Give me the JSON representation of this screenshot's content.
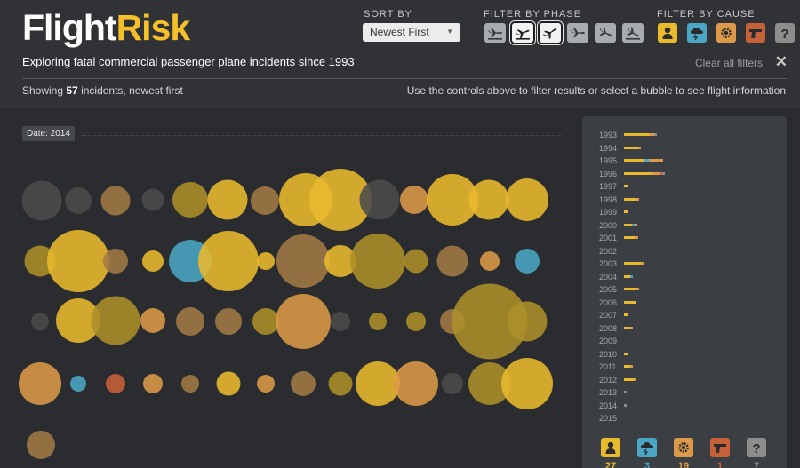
{
  "app": {
    "title_a": "Flight",
    "title_b": "Risk",
    "tagline": "Exploring fatal commercial passenger plane incidents since 1993"
  },
  "controls": {
    "sort_label": "SORT BY",
    "sort_value": "Newest First",
    "phase_label": "FILTER BY PHASE",
    "cause_label": "FILTER BY CAUSE",
    "clear_label": "Clear all filters",
    "phases": [
      "standing",
      "takeoff",
      "climb",
      "cruise",
      "descent",
      "landing"
    ],
    "active_phases": [
      1,
      2
    ],
    "causes": [
      {
        "icon": "person-icon",
        "color": "#e9b92e"
      },
      {
        "icon": "weather-icon",
        "color": "#4aa6c4"
      },
      {
        "icon": "gear-icon",
        "color": "#dc9a48"
      },
      {
        "icon": "gun-icon",
        "color": "#c7613a"
      },
      {
        "icon": "question-icon",
        "color": "#8d8d8d"
      }
    ]
  },
  "status": {
    "showing_prefix": "Showing ",
    "count": "57",
    "showing_suffix": " incidents, newest first",
    "instructions": "Use the controls above to filter results or select a bubble to see flight information"
  },
  "date_tag": "Date: 2014",
  "colors": {
    "human": "#e9b92e",
    "weather": "#4aa6c4",
    "mechanical": "#dc9a48",
    "criminal": "#c7613a",
    "unknown": "#8d8d8d",
    "olive": "#ac8f2a",
    "brown": "#a07a45"
  },
  "timeline": {
    "years": [
      "1993",
      "1994",
      "1995",
      "1996",
      "1997",
      "1998",
      "1999",
      "2000",
      "2001",
      "2002",
      "2003",
      "2004",
      "2005",
      "2006",
      "2007",
      "2008",
      "2009",
      "2010",
      "2011",
      "2012",
      "2013",
      "2014",
      "2015"
    ],
    "breakdown": [
      [
        0.45,
        0,
        0.1,
        0,
        0.05
      ],
      [
        0.25,
        0,
        0.05,
        0,
        0
      ],
      [
        0.35,
        0.1,
        0.25,
        0,
        0
      ],
      [
        0.5,
        0,
        0.15,
        0.05,
        0.05
      ],
      [
        0.07,
        0,
        0,
        0,
        0
      ],
      [
        0.22,
        0,
        0.03,
        0,
        0
      ],
      [
        0.08,
        0,
        0,
        0,
        0
      ],
      [
        0.15,
        0.05,
        0.05,
        0,
        0
      ],
      [
        0.2,
        0,
        0.06,
        0,
        0
      ],
      [
        0,
        0,
        0,
        0,
        0
      ],
      [
        0.3,
        0,
        0.03,
        0,
        0
      ],
      [
        0.12,
        0.05,
        0,
        0,
        0
      ],
      [
        0.22,
        0,
        0.03,
        0,
        0
      ],
      [
        0.22,
        0,
        0,
        0,
        0
      ],
      [
        0.07,
        0,
        0,
        0,
        0
      ],
      [
        0.12,
        0,
        0.03,
        0,
        0
      ],
      [
        0,
        0,
        0,
        0,
        0
      ],
      [
        0.07,
        0,
        0,
        0,
        0
      ],
      [
        0.12,
        0,
        0.03,
        0,
        0
      ],
      [
        0.18,
        0,
        0.05,
        0,
        0
      ],
      [
        0,
        0,
        0,
        0,
        0.05
      ],
      [
        0,
        0,
        0,
        0,
        0.05
      ],
      [
        0,
        0,
        0,
        0,
        0
      ]
    ]
  },
  "legend": [
    {
      "icon": "person-icon",
      "count": "27",
      "color": "#e9b92e"
    },
    {
      "icon": "weather-icon",
      "count": "3",
      "color": "#4aa6c4"
    },
    {
      "icon": "gear-icon",
      "count": "19",
      "color": "#dc9a48"
    },
    {
      "icon": "gun-icon",
      "count": "1",
      "color": "#c7613a"
    },
    {
      "icon": "question-icon",
      "count": "7",
      "color": "#8d8d8d"
    }
  ],
  "incidents": [
    {
      "size": 45,
      "color": "#4b4b4b"
    },
    {
      "size": 30,
      "color": "#4b4b4b"
    },
    {
      "size": 33,
      "color": "#a07a45"
    },
    {
      "size": 25,
      "color": "#4b4b4b"
    },
    {
      "size": 40,
      "color": "#ac8f2a"
    },
    {
      "size": 45,
      "color": "#e9b92e"
    },
    {
      "size": 32,
      "color": "#a07a45"
    },
    {
      "size": 60,
      "color": "#e9b92e"
    },
    {
      "size": 70,
      "color": "#e9b92e"
    },
    {
      "size": 45,
      "color": "#4b4b4b"
    },
    {
      "size": 32,
      "color": "#dc9a48"
    },
    {
      "size": 58,
      "color": "#e9b92e"
    },
    {
      "size": 45,
      "color": "#e9b92e"
    },
    {
      "size": 48,
      "color": "#e9b92e"
    },
    {
      "size": 35,
      "color": "#ac8f2a"
    },
    {
      "size": 70,
      "color": "#e9b92e"
    },
    {
      "size": 28,
      "color": "#a07a45"
    },
    {
      "size": 24,
      "color": "#e9b92e"
    },
    {
      "size": 48,
      "color": "#4aa6c4"
    },
    {
      "size": 68,
      "color": "#e9b92e"
    },
    {
      "size": 20,
      "color": "#e9b92e"
    },
    {
      "size": 60,
      "color": "#a07a45"
    },
    {
      "size": 36,
      "color": "#e9b92e"
    },
    {
      "size": 62,
      "color": "#ac8f2a"
    },
    {
      "size": 27,
      "color": "#ac8f2a"
    },
    {
      "size": 35,
      "color": "#a07a45"
    },
    {
      "size": 22,
      "color": "#dc9a48"
    },
    {
      "size": 28,
      "color": "#4aa6c4"
    },
    {
      "size": 20,
      "color": "#4b4b4b"
    },
    {
      "size": 50,
      "color": "#e9b92e"
    },
    {
      "size": 55,
      "color": "#ac8f2a"
    },
    {
      "size": 28,
      "color": "#dc9a48"
    },
    {
      "size": 32,
      "color": "#a07a45"
    },
    {
      "size": 30,
      "color": "#a07a45"
    },
    {
      "size": 30,
      "color": "#ac8f2a"
    },
    {
      "size": 62,
      "color": "#dc9a48"
    },
    {
      "size": 22,
      "color": "#4b4b4b"
    },
    {
      "size": 20,
      "color": "#ac8f2a"
    },
    {
      "size": 22,
      "color": "#ac8f2a"
    },
    {
      "size": 28,
      "color": "#a07a45"
    },
    {
      "size": 85,
      "color": "#ac8f2a"
    },
    {
      "size": 45,
      "color": "#ac8f2a"
    },
    {
      "size": 48,
      "color": "#dc9a48"
    },
    {
      "size": 18,
      "color": "#4aa6c4"
    },
    {
      "size": 22,
      "color": "#c7613a"
    },
    {
      "size": 22,
      "color": "#dc9a48"
    },
    {
      "size": 20,
      "color": "#a07a45"
    },
    {
      "size": 27,
      "color": "#e9b92e"
    },
    {
      "size": 20,
      "color": "#dc9a48"
    },
    {
      "size": 28,
      "color": "#a07a45"
    },
    {
      "size": 27,
      "color": "#ac8f2a"
    },
    {
      "size": 50,
      "color": "#e9b92e"
    },
    {
      "size": 50,
      "color": "#dc9a48"
    },
    {
      "size": 24,
      "color": "#4b4b4b"
    },
    {
      "size": 48,
      "color": "#ac8f2a"
    },
    {
      "size": 58,
      "color": "#e9b92e"
    },
    {
      "size": 32,
      "color": "#a07a45"
    }
  ]
}
